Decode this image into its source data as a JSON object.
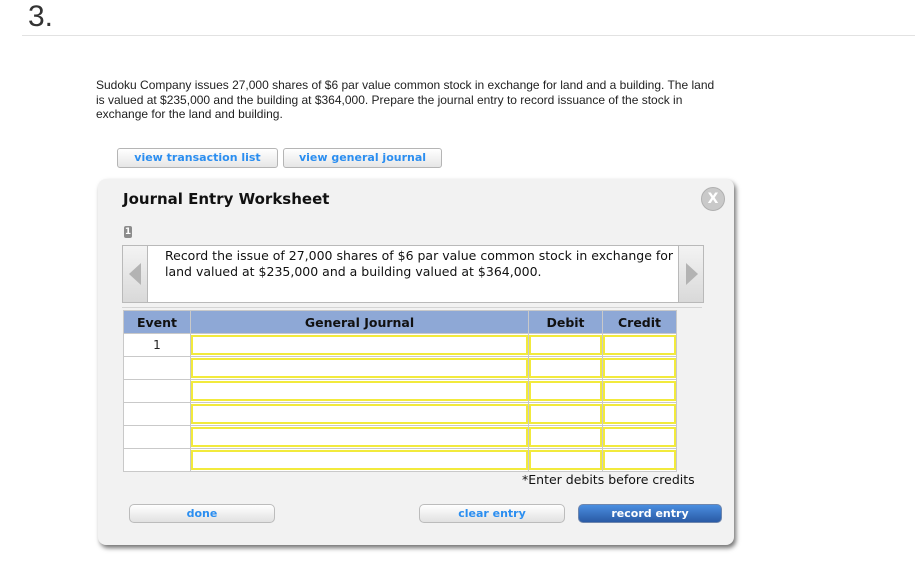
{
  "question": {
    "number": "3.",
    "text": "Sudoku Company issues 27,000 shares of $6 par value common stock in exchange for land and a building. The land is valued at $235,000 and the building at $364,000. Prepare the journal entry to record issuance of the stock in exchange for the land and building."
  },
  "top_buttons": {
    "transaction_list": "view transaction list",
    "general_journal": "view general journal"
  },
  "worksheet": {
    "title": "Journal Entry Worksheet",
    "close_label": "X",
    "step": "1",
    "description": "Record the issue of 27,000 shares of $6 par value common stock in exchange for land valued at $235,000 and a building valued at $364,000.",
    "table": {
      "headers": [
        "Event",
        "General Journal",
        "Debit",
        "Credit"
      ],
      "rows": [
        {
          "event": "1",
          "general_journal": "",
          "debit": "",
          "credit": ""
        },
        {
          "event": "",
          "general_journal": "",
          "debit": "",
          "credit": ""
        },
        {
          "event": "",
          "general_journal": "",
          "debit": "",
          "credit": ""
        },
        {
          "event": "",
          "general_journal": "",
          "debit": "",
          "credit": ""
        },
        {
          "event": "",
          "general_journal": "",
          "debit": "",
          "credit": ""
        },
        {
          "event": "",
          "general_journal": "",
          "debit": "",
          "credit": ""
        }
      ]
    },
    "note": "*Enter debits before credits",
    "buttons": {
      "done": "done",
      "clear_entry": "clear entry",
      "record_entry": "record entry"
    }
  },
  "colors": {
    "link_blue": "#2b8ef0",
    "header_blue": "#8ea8d6",
    "input_yellow": "#f2ea3c",
    "record_button": "#2a5aa5"
  }
}
